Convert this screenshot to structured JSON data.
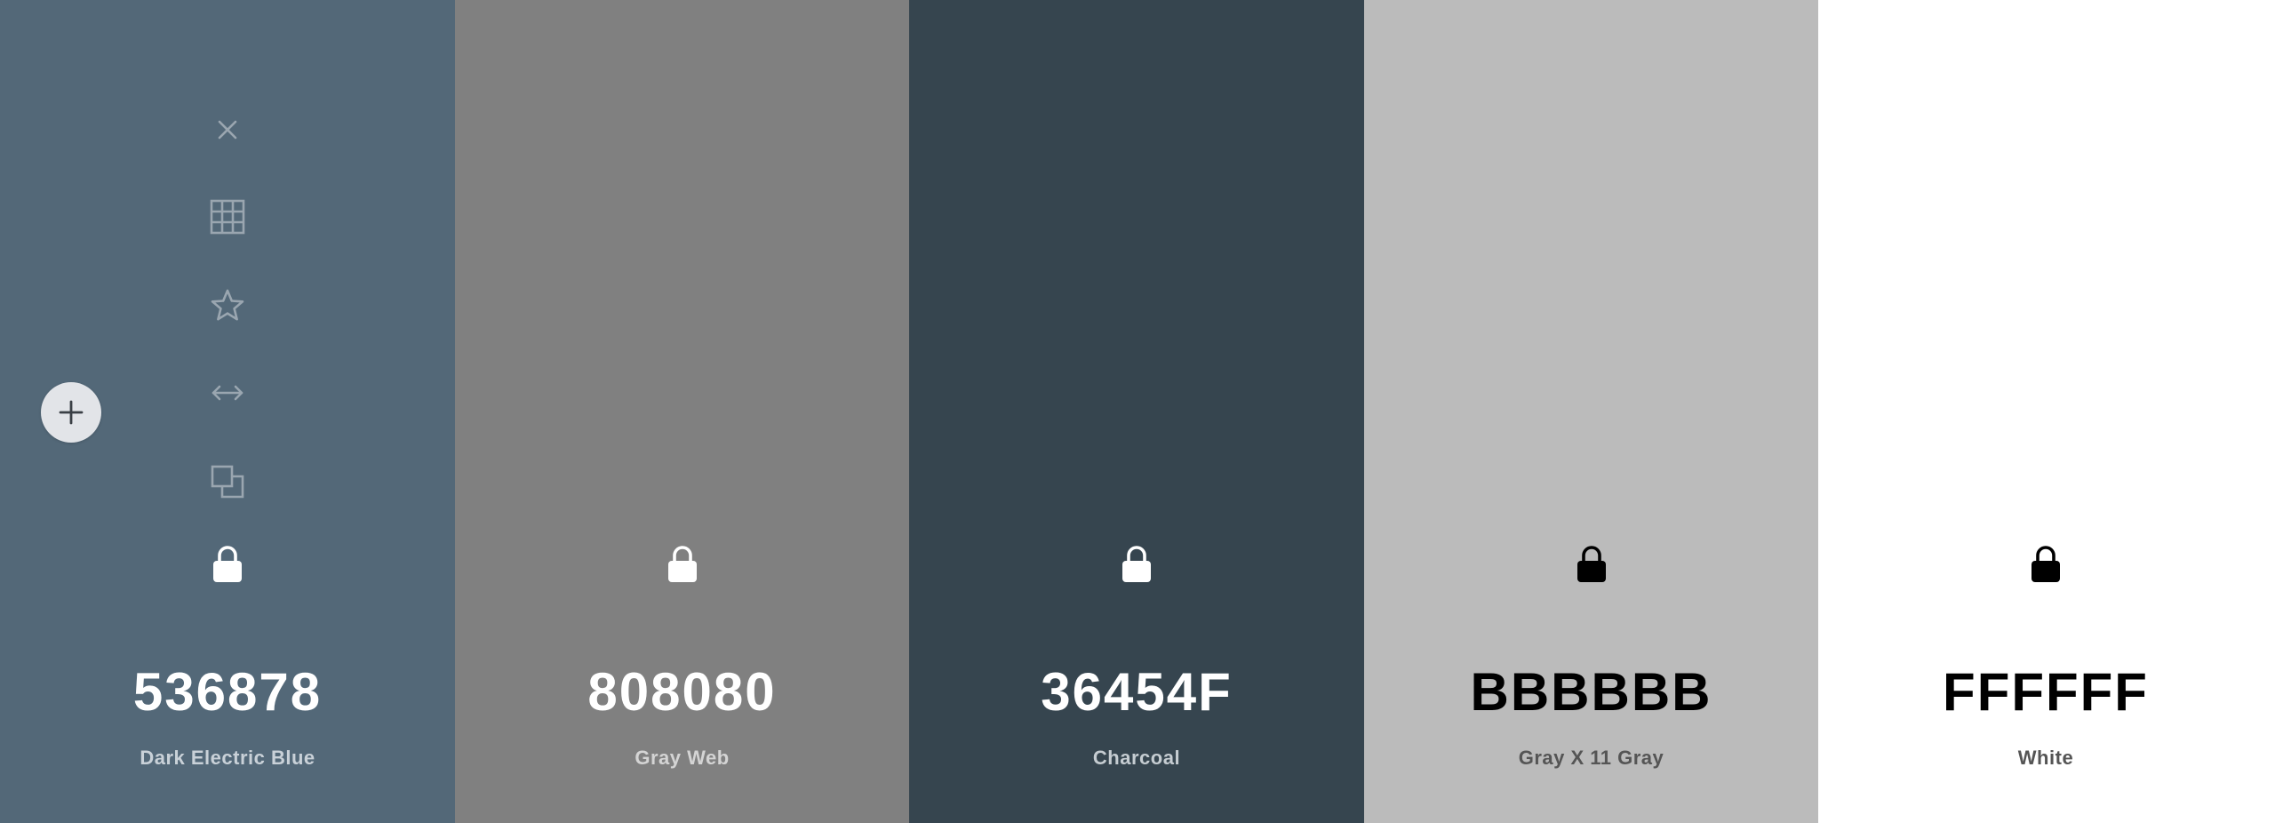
{
  "colors": [
    {
      "hex": "536878",
      "name": "Dark Electric Blue",
      "bg": "#536878",
      "text": "#FFFFFF",
      "subtext": "#C9D1D8"
    },
    {
      "hex": "808080",
      "name": "Gray Web",
      "bg": "#808080",
      "text": "#FFFFFF",
      "subtext": "#D4D4D4"
    },
    {
      "hex": "36454F",
      "name": "Charcoal",
      "bg": "#36454F",
      "text": "#FFFFFF",
      "subtext": "#C5CCD1"
    },
    {
      "hex": "BBBBBB",
      "name": "Gray X 11 Gray",
      "bg": "#BBBBBB",
      "text": "#000000",
      "subtext": "#555555"
    },
    {
      "hex": "FFFFFF",
      "name": "White",
      "bg": "#FFFFFF",
      "text": "#000000",
      "subtext": "#555555"
    }
  ],
  "toolbar": {
    "icons": [
      "close-icon",
      "grid-icon",
      "star-icon",
      "arrows-horizontal-icon",
      "copy-icon"
    ],
    "icon_color": "#9AA6B0"
  },
  "add_button": {
    "icon": "plus-icon"
  }
}
